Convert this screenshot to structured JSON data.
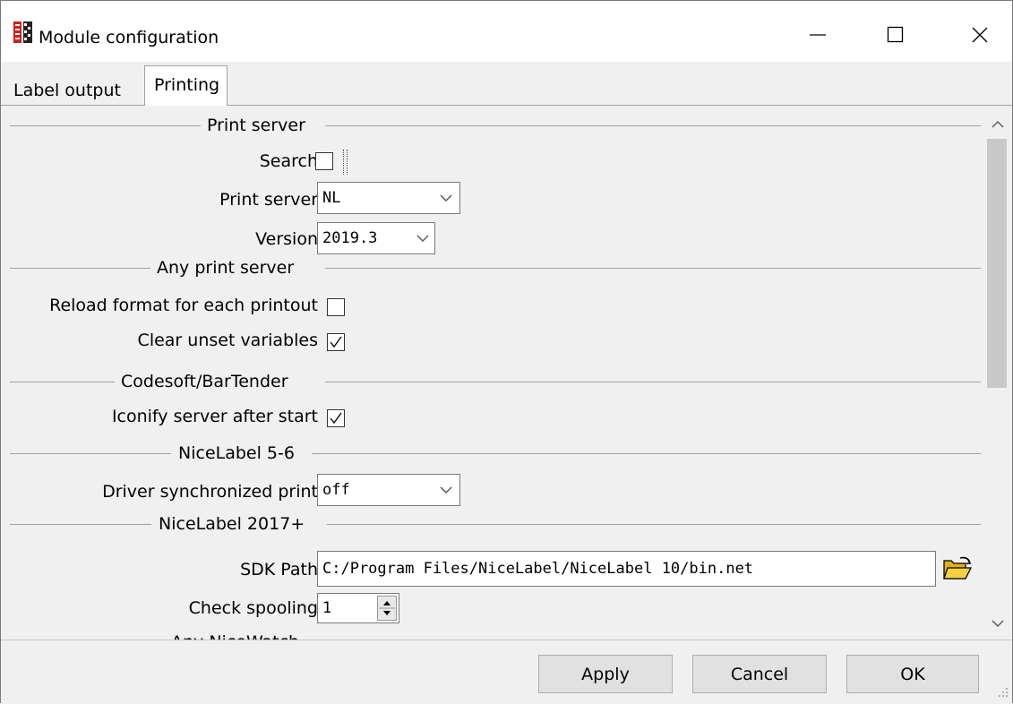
{
  "window": {
    "title": "Module configuration"
  },
  "tabs": [
    {
      "label": "Label output",
      "active": false
    },
    {
      "label": "Printing",
      "active": true
    }
  ],
  "sections": {
    "print_server": "Print server",
    "any_print_server": "Any print server",
    "codesoft": "Codesoft/BarTender",
    "nicelabel56": "NiceLabel 5-6",
    "nicelabel2017": "NiceLabel 2017+",
    "any_nicewatch": "Any NiceWatch"
  },
  "fields": {
    "search": {
      "label": "Search",
      "checked": false
    },
    "print_server": {
      "label": "Print server",
      "value": "NL"
    },
    "version": {
      "label": "Version",
      "value": "2019.3"
    },
    "reload_format": {
      "label": "Reload format for each printout",
      "checked": false
    },
    "clear_unset": {
      "label": "Clear unset variables",
      "checked": true
    },
    "iconify": {
      "label": "Iconify server after start",
      "checked": true
    },
    "driver_sync": {
      "label": "Driver synchronized print",
      "value": "off"
    },
    "sdk_path": {
      "label": "SDK Path",
      "value": "C:/Program Files/NiceLabel/NiceLabel 10/bin.net"
    },
    "check_spooling": {
      "label": "Check spooling",
      "value": "1"
    }
  },
  "buttons": {
    "apply": "Apply",
    "cancel": "Cancel",
    "ok": "OK"
  },
  "icons": {
    "app": "print-app-icon",
    "folder": "folder-open-icon"
  },
  "colors": {
    "folder_yellow": "#f0c020",
    "app_red": "#cc2020"
  }
}
